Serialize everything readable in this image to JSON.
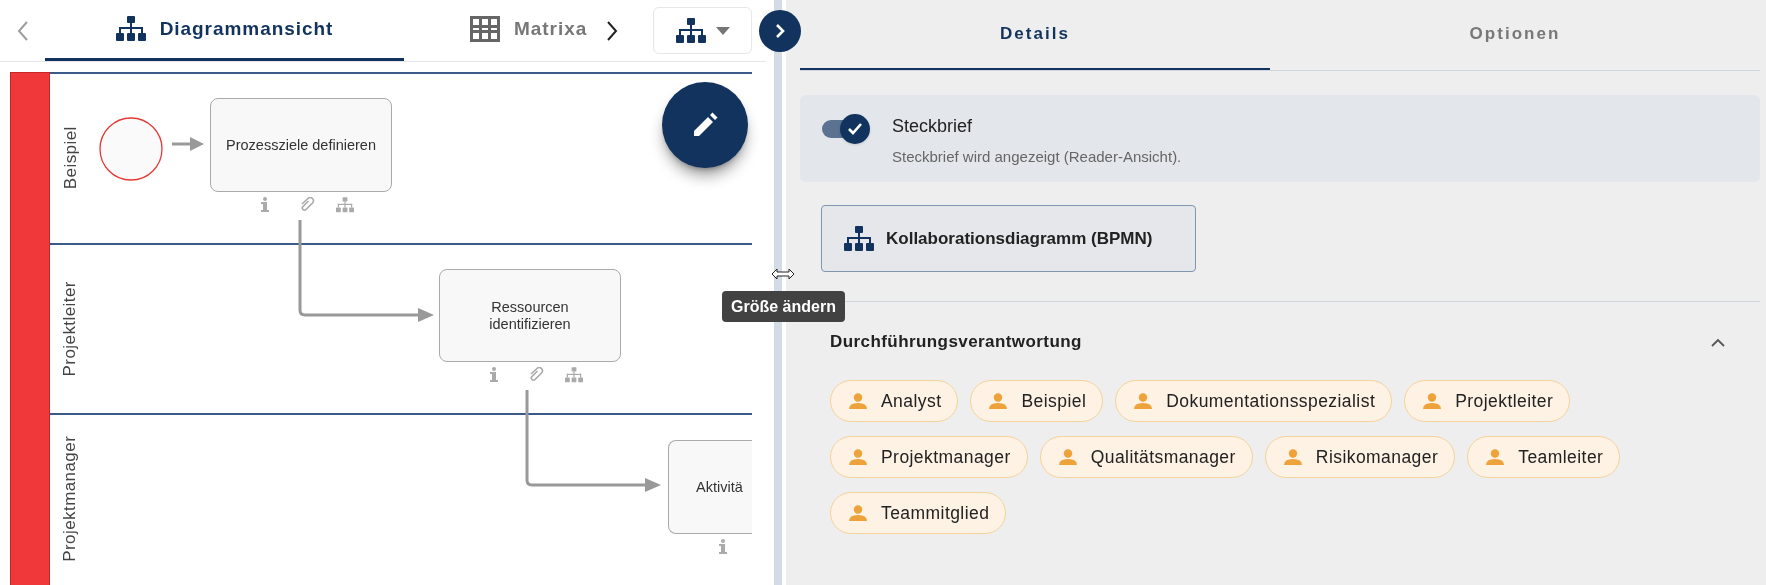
{
  "left_tabs": [
    {
      "label": "Diagrammansicht",
      "kind": "hierarchy",
      "selected": true
    },
    {
      "label": "Matrixa",
      "kind": "grid",
      "selected": false
    }
  ],
  "diagram": {
    "lanes": [
      {
        "label": "Beispiel"
      },
      {
        "label": "Projektleiter"
      },
      {
        "label": "Projektmanager"
      }
    ],
    "tasks": [
      {
        "label": "Prozessziele definieren"
      },
      {
        "label": "Ressourcen identifizieren"
      },
      {
        "label": "Aktivitä"
      }
    ]
  },
  "tooltip": "Größe ändern",
  "right_tabs": [
    {
      "label": "Details",
      "selected": true
    },
    {
      "label": "Optionen",
      "selected": false
    }
  ],
  "profile_toggle": {
    "title": "Steckbrief",
    "description": "Steckbrief wird angezeigt (Reader-Ansicht).",
    "on": true
  },
  "diagram_button": "Kollaborationsdiagramm (BPMN)",
  "responsibility": {
    "title": "Durchführungsverantwortung",
    "expanded": true,
    "roles": [
      "Analyst",
      "Beispiel",
      "Dokumentationsspezialist",
      "Projektleiter",
      "Projektmanager",
      "Qualitätsmanager",
      "Risikomanager",
      "Teamleiter",
      "Teammitglied"
    ]
  }
}
